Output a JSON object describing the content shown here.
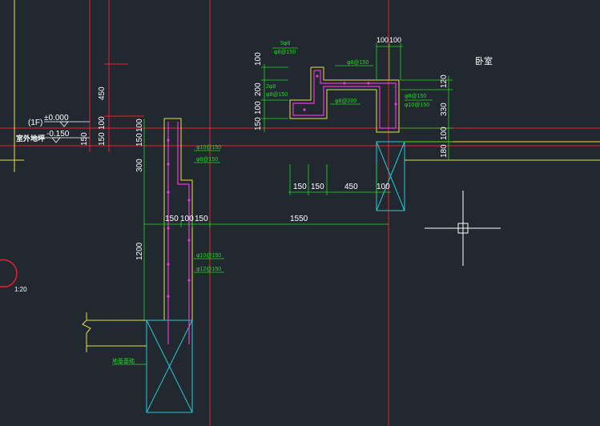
{
  "viewport": {
    "background": "#212830"
  },
  "colors": {
    "axis_red": "#e8222a",
    "wall_yellow": "#e8e04a",
    "dim_green": "#22d822",
    "rebar_magenta": "#e63ad6",
    "pile_cyan": "#29c8d8",
    "text_white": "#ffffff"
  },
  "elevations": {
    "floor_label": "(1F)",
    "floor_level": "±0.000",
    "outdoor_label": "室外地坪",
    "outdoor_level": "-0.150"
  },
  "room": {
    "label": "卧室"
  },
  "scale": {
    "label": "1:20"
  },
  "dimensions": {
    "left_vertical": [
      "450",
      "100",
      "150",
      "150",
      "100",
      "150",
      "300",
      "1200"
    ],
    "top_vertical": [
      "100",
      "200",
      "100",
      "150"
    ],
    "right_vertical": [
      "120",
      "330",
      "100",
      "180"
    ],
    "top_horizontal": [
      "100",
      "100"
    ],
    "mid_horizontal": [
      "150",
      "150",
      "450",
      "100"
    ],
    "bottom_horizontal": [
      "150",
      "100",
      "150",
      "1550"
    ]
  },
  "rebar_callouts": {
    "top_left_a": "5φ8",
    "top_left_b": "φ8@150",
    "top_right": "φ8@150",
    "top_mid_a": "2φ8",
    "top_mid_b": "φ8@150",
    "mid_a": "φ8@200",
    "mid_b": "φ8@150",
    "mid_c": "φ10@150",
    "wall_a": "φ10@150",
    "wall_b": "φ8@150",
    "wall_c": "φ10@150",
    "wall_d": "φ12@150",
    "foundation": "地基基础"
  },
  "tools": {
    "crosshair": "crosshair-cursor-icon"
  }
}
